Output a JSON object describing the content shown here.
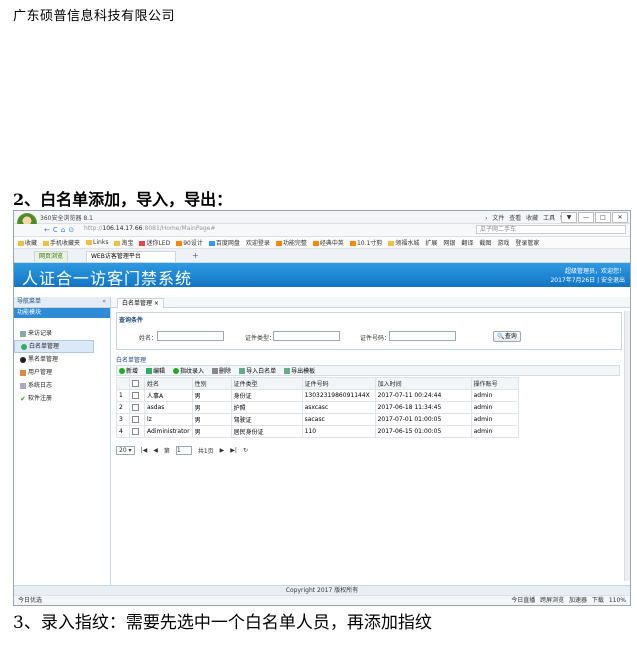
{
  "doc": {
    "company": "广东硕普信息科技有限公司",
    "heading2": "2、白名单添加，导入，导出：",
    "heading3": "3、录入指纹：需要先选中一个白名单人员，再添加指纹"
  },
  "browser": {
    "title": "360安全浏览器 8.1",
    "menu": "› 文件 查看 收藏 工具 帮助",
    "win_controls": [
      "▼",
      "—",
      "□",
      "✕"
    ],
    "nav": [
      "←",
      "C",
      "⌂",
      "⊙"
    ],
    "url_scheme": "http://",
    "url_host": "106.14.17.66",
    "url_rest": ":8081/Home/MainPage#",
    "search_placeholder": "瓜子网二手车",
    "favorites": [
      "收藏",
      "手机收藏夹",
      "Links",
      "淘宝",
      "迷你LED",
      "90设计",
      "百度网盘",
      "欢迎登录",
      "功能完整",
      "经典中英",
      "10.1寸剪",
      "领福水城",
      "扩展",
      "网银",
      "翻译",
      "截图",
      "游戏",
      "登录管家"
    ],
    "tabs": [
      "网页浏览",
      "WEB访客管理平台"
    ],
    "tab_plus": "+"
  },
  "app": {
    "title": "人证合一访客门禁系统",
    "user_line1": "超级管理员，欢迎您！",
    "user_line2": "2017年7月26日 | 安全退出",
    "sidebar": {
      "header": "导航菜单",
      "collapse": "«",
      "module": "功能模块",
      "items": [
        "来访记录",
        "白名单管理",
        "黑名单管理",
        "用户管理",
        "系统日志",
        "软件注册"
      ]
    },
    "content_tab": "白名单管理 ×",
    "query": {
      "title": "查询条件",
      "name_label": "姓名：",
      "idtype_label": "证件类型：",
      "idno_label": "证件号码：",
      "search_button": "查询"
    },
    "grid_title": "白名单管理",
    "toolbar": [
      "新增",
      "编辑",
      "指纹录入",
      "删除",
      "导入白名单",
      "导出模板"
    ],
    "columns": [
      "",
      "",
      "姓名",
      "性别",
      "证件类型",
      "证件号码",
      "加入时间",
      "操作账号"
    ],
    "rows": [
      [
        "1",
        "人事A",
        "男",
        "身份证",
        "1303231986091144X",
        "2017-07-11 00:24:44",
        "admin"
      ],
      [
        "2",
        "asdas",
        "男",
        "护照",
        "asxcasc",
        "2017-06-18 11:34:45",
        "admin"
      ],
      [
        "3",
        "lz",
        "男",
        "驾驶证",
        "sacasc",
        "2017-07-01 01:00:05",
        "admin"
      ],
      [
        "4",
        "Adiministrator",
        "男",
        "居民身份证",
        "110",
        "2017-06-15 01:00:05",
        "admin"
      ]
    ],
    "pager": {
      "page_size": "20",
      "page_label": "第",
      "page_value": "1",
      "total": "共1页",
      "first": "|◀",
      "prev": "◀",
      "next": "▶",
      "last": "▶|",
      "refresh": "↻"
    },
    "footer": "Copyright 2017 版权所有"
  },
  "statusbar": {
    "left": "今日优选",
    "right": "今日直播  跨屏浏览  加速器  下载  110%"
  },
  "colors": {
    "banner": "#1275c4",
    "module": "#2f8ad8"
  }
}
